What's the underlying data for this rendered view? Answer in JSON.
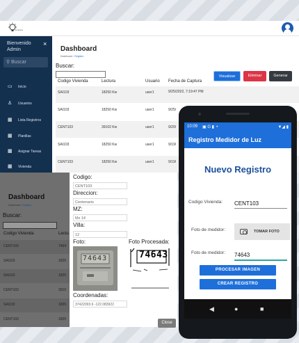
{
  "header": {
    "logo": "lightbulb-logo",
    "logo_text": "company"
  },
  "sidebar": {
    "greeting": "Bienvenido Admin",
    "close": "×",
    "search_placeholder": "Buscar",
    "items": [
      {
        "icon": "monitor-icon",
        "label": "Inicio"
      },
      {
        "icon": "user-icon",
        "label": "Usuarios"
      },
      {
        "icon": "grid-icon",
        "label": "Lista Registros"
      },
      {
        "icon": "grid-icon",
        "label": "Planillas"
      },
      {
        "icon": "grid-icon",
        "label": "Asignar Tareas"
      },
      {
        "icon": "grid-icon",
        "label": "Vivienda"
      }
    ]
  },
  "main": {
    "title": "Dashboard",
    "breadcrumb": [
      "Dashboard",
      "Registro"
    ],
    "search_label": "Buscar:",
    "columns": [
      "Codigo Vivienda",
      "Lectura",
      "Usuario",
      "Fecha de Captura"
    ],
    "rows": [
      {
        "codigo": "SAI103",
        "lectura": "18250 Kw",
        "usuario": "user1",
        "fecha": "9/25/2022, 7:19:47 PM"
      },
      {
        "codigo": "SAI103",
        "lectura": "18250 Kw",
        "usuario": "user1",
        "fecha": "9/25/"
      },
      {
        "codigo": "CENT103",
        "lectura": "39102 Kw",
        "usuario": "user1",
        "fecha": "9/20/"
      },
      {
        "codigo": "SAI103",
        "lectura": "18250 Kw",
        "usuario": "user1",
        "fecha": "9/19/"
      },
      {
        "codigo": "CENT103",
        "lectura": "18250 Kw",
        "usuario": "user1",
        "fecha": "9/19/"
      }
    ],
    "actions": {
      "view": "Visualizar",
      "delete": "Eliminar",
      "generate": "Generar"
    }
  },
  "behind": {
    "title": "Dashboard",
    "breadcrumb": [
      "Dashboard",
      "Registro"
    ],
    "search_label": "Buscar:",
    "columns": [
      "Codigo Vivienda",
      "Lectu"
    ],
    "rows": [
      [
        "CENT103",
        "7464"
      ],
      [
        "SAI103",
        "1825"
      ],
      [
        "SAI103",
        "1825"
      ],
      [
        "CENT103",
        "3910"
      ],
      [
        "SAI103",
        "1825"
      ],
      [
        "CENT103",
        "1825"
      ]
    ]
  },
  "modal": {
    "codigo_label": "Codigo:",
    "codigo_value": "CENT103",
    "direccion_label": "Direccion:",
    "direccion_value": "Centenario",
    "mz_label": "MZ:",
    "mz_value": "Mz 14",
    "villa_label": "Villa:",
    "villa_value": "12",
    "foto_label": "Foto:",
    "foto_procesada_label": "Foto Procesada:",
    "meter_digits": "74643",
    "coordenadas_label": "Coordenadas:",
    "coordenadas_value": "37422093.6 -122.083922",
    "close_label": "Close"
  },
  "phone": {
    "time": "10:09",
    "status_icons": "▼◢ ▮",
    "app_title": "Registro Medidor de Luz",
    "heading": "Nuevo Registro",
    "codigo_label": "Codigo Vivienda:",
    "codigo_value": "CENT103",
    "foto_label": "Foto de medidor:",
    "take_photo": "TOMAR FOTO",
    "foto2_label": "Foto de medidor:",
    "reading_value": "74643",
    "process_btn": "PROCESAR IMAGEN",
    "create_btn": "CREAR REGISTRO"
  },
  "colors": {
    "sidebar": "#13304f",
    "primary": "#1e6fd9",
    "danger": "#dc3545",
    "dark": "#343a40"
  }
}
